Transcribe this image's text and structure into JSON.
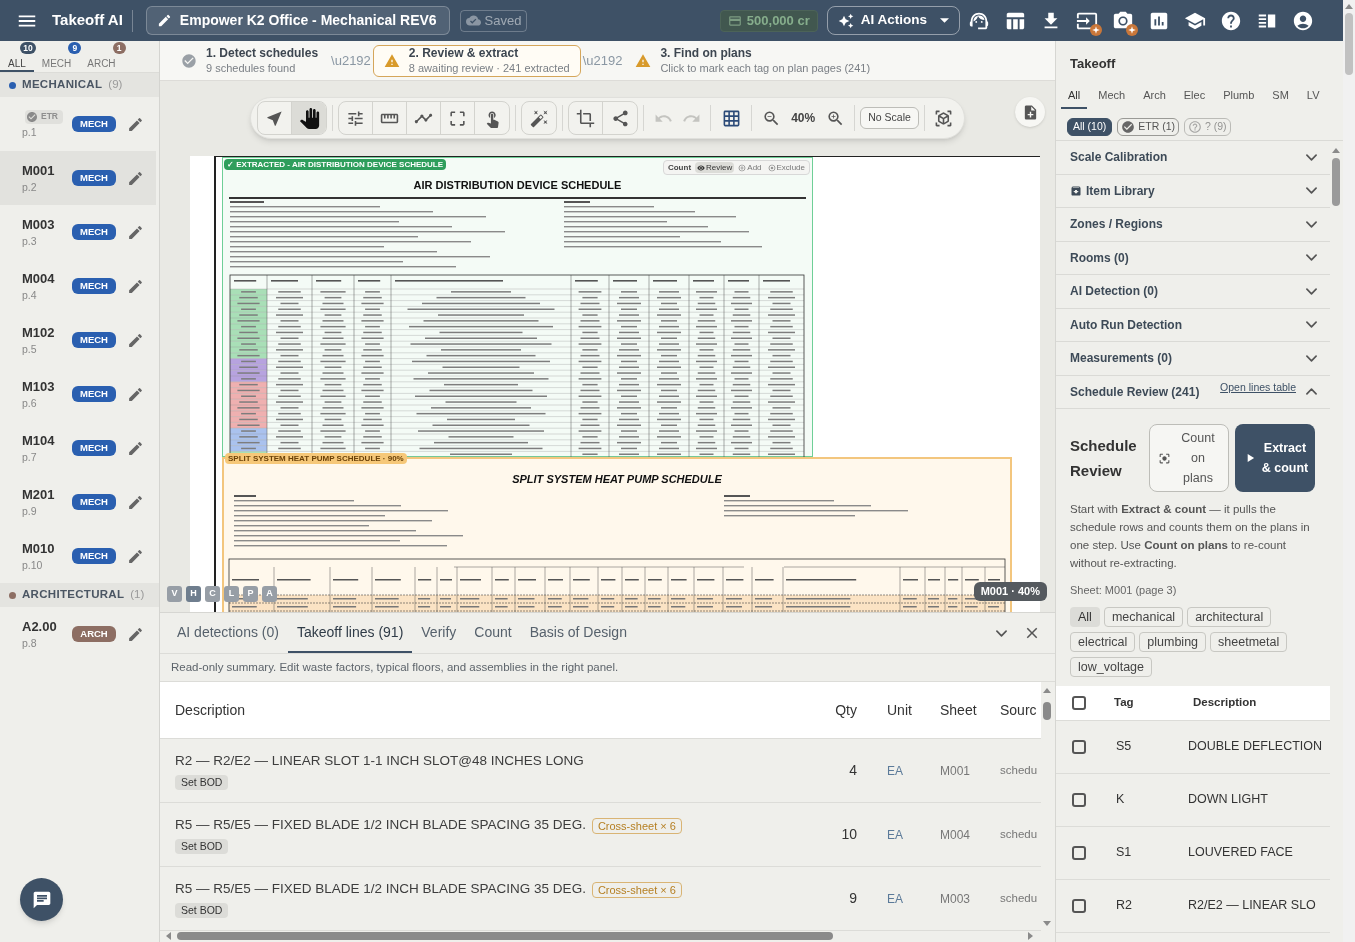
{
  "top_bar": {
    "app_name": "Takeoff AI",
    "project_title": "Empower K2 Office - Mechanical REV6",
    "save_status": "Saved",
    "credits": "500,000 cr",
    "ai_actions": "AI Actions",
    "icons": [
      {
        "kind": "support",
        "badge": false
      },
      {
        "kind": "table",
        "badge": false
      },
      {
        "kind": "download",
        "badge": false
      },
      {
        "kind": "import",
        "badge": true
      },
      {
        "kind": "camera",
        "badge": true
      },
      {
        "kind": "chart",
        "badge": false
      },
      {
        "kind": "learn",
        "badge": false
      },
      {
        "kind": "help",
        "badge": false
      },
      {
        "kind": "panel",
        "badge": false
      },
      {
        "kind": "account",
        "badge": false
      }
    ]
  },
  "sidebar": {
    "tabs": [
      {
        "label": "ALL",
        "count": "10",
        "selected": true,
        "color": "#3e5166"
      },
      {
        "label": "MECH",
        "count": "9",
        "selected": false,
        "color": "#2a5fb0"
      },
      {
        "label": "ARCH",
        "count": "1",
        "selected": false,
        "color": "#8d6e63"
      }
    ],
    "groups": [
      {
        "name": "MECHANICAL",
        "count": "(9)",
        "color": "#2a5fb0",
        "sheets": [
          {
            "status": "ETR",
            "page": "p.1",
            "badge": "MECH",
            "selected": false
          },
          {
            "name": "M001",
            "page": "p.2",
            "badge": "MECH",
            "selected": true
          },
          {
            "name": "M003",
            "page": "p.3",
            "badge": "MECH",
            "selected": false
          },
          {
            "name": "M004",
            "page": "p.4",
            "badge": "MECH",
            "selected": false
          },
          {
            "name": "M102",
            "page": "p.5",
            "badge": "MECH",
            "selected": false
          },
          {
            "name": "M103",
            "page": "p.6",
            "badge": "MECH",
            "selected": false
          },
          {
            "name": "M104",
            "page": "p.7",
            "badge": "MECH",
            "selected": false
          },
          {
            "name": "M201",
            "page": "p.9",
            "badge": "MECH",
            "selected": false
          },
          {
            "name": "M010",
            "page": "p.10",
            "badge": "MECH",
            "selected": false
          }
        ]
      },
      {
        "name": "ARCHITECTURAL",
        "count": "(1)",
        "color": "#8d6e63",
        "sheets": [
          {
            "name": "A2.00",
            "page": "p.8",
            "badge": "ARCH",
            "selected": false
          }
        ]
      }
    ]
  },
  "steps": [
    {
      "kind": "done",
      "title": "1. Detect schedules",
      "detail": "9 schedules found",
      "selected": false
    },
    {
      "kind": "warning",
      "title": "2. Review & extract",
      "detail": "8 awaiting review · 241 extracted",
      "selected": true
    },
    {
      "kind": "warning",
      "title": "3. Find on plans",
      "detail": "Click to mark each tag on plan pages (241)",
      "selected": false
    }
  ],
  "step_separators": [
    "\\u2192",
    "\\u2192"
  ],
  "toolbar": {
    "groups": [
      {
        "kind": "segmented",
        "items": [
          {
            "kind": "select",
            "selected": false
          },
          {
            "kind": "pan",
            "selected": true
          }
        ]
      },
      {
        "kind": "segmented",
        "items": [
          {
            "kind": "adjust",
            "selected": false
          },
          {
            "kind": "measure",
            "selected": false
          },
          {
            "kind": "polyline",
            "selected": false
          },
          {
            "kind": "area",
            "selected": false
          },
          {
            "kind": "tap",
            "selected": false
          }
        ]
      },
      {
        "kind": "segmented",
        "items": [
          {
            "kind": "markup",
            "selected": false
          }
        ]
      },
      {
        "kind": "segmented",
        "items": [
          {
            "kind": "crop",
            "selected": false
          },
          {
            "kind": "connect",
            "selected": false
          }
        ]
      },
      {
        "kind": "plain",
        "items": [
          {
            "kind": "undo",
            "disabled": true
          },
          {
            "kind": "redo",
            "disabled": true
          }
        ]
      },
      {
        "kind": "plain",
        "items": [
          {
            "kind": "grid",
            "on": true
          }
        ]
      },
      {
        "kind": "plain",
        "items": [
          {
            "kind": "zoom_out"
          },
          {
            "kind": "zoom_level",
            "label": "40%"
          },
          {
            "kind": "zoom_in"
          }
        ]
      },
      {
        "kind": "plain",
        "items": [
          {
            "kind": "scale",
            "label": "No Scale"
          }
        ]
      },
      {
        "kind": "plain",
        "items": [
          {
            "kind": "cube"
          }
        ]
      }
    ]
  },
  "canvas": {
    "schedules": [
      {
        "kind": "extracted",
        "title": "AIR DISTRIBUTION DEVICE SCHEDULE",
        "tag": "✓ EXTRACTED - AIR DISTRIBUTION DEVICE SCHEDULE"
      },
      {
        "kind": "pending",
        "title": "SPLIT SYSTEM HEAT PUMP SCHEDULE",
        "tag": "SPLIT SYSTEM HEAT PUMP SCHEDULE · 90%"
      }
    ],
    "review_actions": [
      {
        "kind": "count",
        "label": "Count"
      },
      {
        "kind": "review",
        "label": "Review",
        "selected": true
      },
      {
        "kind": "add",
        "label": "Add",
        "selected": false
      },
      {
        "kind": "exclude",
        "label": "Exclude",
        "selected": false
      }
    ],
    "view_buttons": [
      {
        "label": "V",
        "selected": false
      },
      {
        "label": "H",
        "selected": true
      },
      {
        "label": "C",
        "selected": false
      },
      {
        "label": "L",
        "selected": false
      },
      {
        "label": "P",
        "selected": false
      },
      {
        "label": "A",
        "selected": false
      }
    ],
    "view_label": "M001 · 40%"
  },
  "bottom_panel": {
    "tabs": [
      {
        "label": "AI detections (0)",
        "selected": false
      },
      {
        "label": "Takeoff lines (91)",
        "selected": true
      },
      {
        "label": "Verify",
        "selected": false
      },
      {
        "label": "Count",
        "selected": false
      },
      {
        "label": "Basis of Design",
        "selected": false
      }
    ],
    "note": "Read-only summary. Edit waste factors, typical floors, and assemblies in the right panel.",
    "table": {
      "columns": [
        "Description",
        "Qty",
        "Unit",
        "Sheet",
        "Sourc"
      ],
      "rows": [
        {
          "description": "R2 — R2/E2 — LINEAR SLOT 1-1 INCH SLOT@48 INCHES LONG",
          "action": "Set BOD",
          "qty": "4",
          "unit": "EA",
          "sheet": "M001",
          "source": "schedu"
        },
        {
          "description": "R5 — R5/E5 — FIXED BLADE 1/2 INCH BLADE SPACING 35 DEG.",
          "flag": "Cross-sheet × 6",
          "action": "Set BOD",
          "qty": "10",
          "unit": "EA",
          "sheet": "M004",
          "source": "schedu"
        },
        {
          "description": "R5 — R5/E5 — FIXED BLADE 1/2 INCH BLADE SPACING 35 DEG.",
          "flag": "Cross-sheet × 6",
          "action": "Set BOD",
          "qty": "9",
          "unit": "EA",
          "sheet": "M003",
          "source": "schedu"
        }
      ]
    }
  },
  "right_panel": {
    "title": "Takeoff",
    "tabs": [
      {
        "label": "All",
        "selected": true
      },
      {
        "label": "Mech",
        "selected": false
      },
      {
        "label": "Arch",
        "selected": false
      },
      {
        "label": "Elec",
        "selected": false
      },
      {
        "label": "Plumb",
        "selected": false
      },
      {
        "label": "SM",
        "selected": false
      },
      {
        "label": "LV",
        "selected": false
      }
    ],
    "filters": [
      {
        "kind": "all",
        "label": "All (10)",
        "selected": true,
        "disabled": false
      },
      {
        "kind": "etr",
        "label": "ETR (1)",
        "selected": false,
        "disabled": false
      },
      {
        "kind": "unknown",
        "label": "? (9)",
        "selected": false,
        "disabled": true
      }
    ],
    "sections": [
      {
        "kind": "plain",
        "title": "Scale Calibration",
        "expanded": false
      },
      {
        "kind": "library",
        "title": "Item Library",
        "expanded": false
      },
      {
        "kind": "plain",
        "title": "Zones / Regions",
        "expanded": false
      },
      {
        "kind": "plain",
        "title": "Rooms (0)",
        "expanded": false
      },
      {
        "kind": "plain",
        "title": "AI Detection (0)",
        "expanded": false
      },
      {
        "kind": "plain",
        "title": "Auto Run Detection",
        "expanded": false
      },
      {
        "kind": "plain",
        "title": "Measurements (0)",
        "expanded": false
      },
      {
        "kind": "schedule",
        "title": "Schedule Review (241)",
        "expanded": true,
        "link": "Open lines table"
      }
    ],
    "schedule_review": {
      "heading": "Schedule Review",
      "count_button": "Count on plans",
      "extract_button": "Extract & count",
      "help": "Start with **Extract & count** — it pulls the schedule rows and counts them on the plans in one step. Use **Count on plans** to re-count without re-extracting.",
      "sheet": "Sheet: M001 (page 3)",
      "categories": [
        {
          "label": "All",
          "selected": true
        },
        {
          "label": "mechanical",
          "selected": false
        },
        {
          "label": "architectural",
          "selected": false
        },
        {
          "label": "electrical",
          "selected": false
        },
        {
          "label": "plumbing",
          "selected": false
        },
        {
          "label": "sheetmetal",
          "selected": false
        },
        {
          "label": "low_voltage",
          "selected": false
        }
      ],
      "table": {
        "columns": [
          "Tag",
          "Description"
        ],
        "all_checked": false,
        "rows": [
          {
            "tag": "S5",
            "description": "DOUBLE DEFLECTION",
            "checked": false
          },
          {
            "tag": "K",
            "description": "DOWN LIGHT",
            "checked": false
          },
          {
            "tag": "S1",
            "description": "LOUVERED FACE",
            "checked": false
          },
          {
            "tag": "R2",
            "description": "R2/E2 — LINEAR SLO",
            "checked": false
          }
        ]
      }
    }
  }
}
